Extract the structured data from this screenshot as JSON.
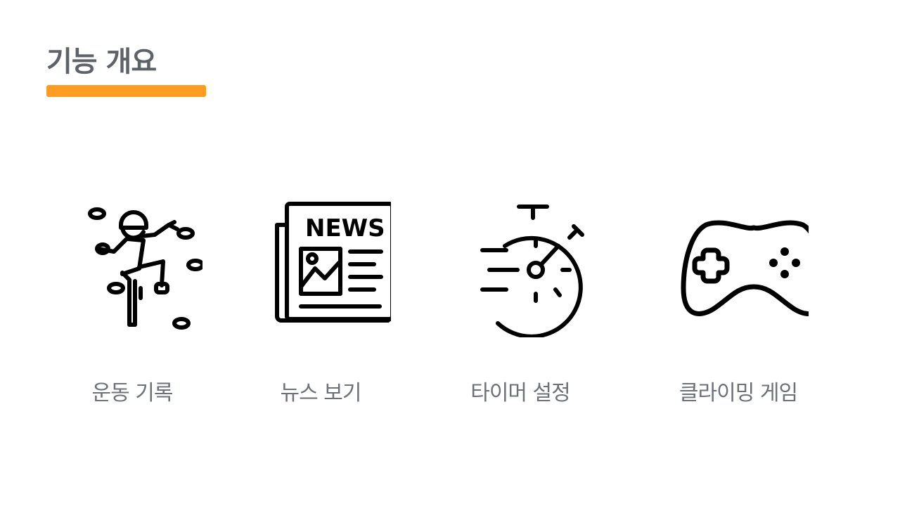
{
  "header": {
    "title": "기능 개요",
    "accent_color": "#ff9d23",
    "title_color": "#5d6369"
  },
  "features": [
    {
      "icon": "climber-icon",
      "label": "운동 기록"
    },
    {
      "icon": "newspaper-icon",
      "label": "뉴스 보기",
      "icon_text": "NEWS"
    },
    {
      "icon": "stopwatch-icon",
      "label": "타이머 설정"
    },
    {
      "icon": "gamepad-icon",
      "label": "클라이밍 게임"
    }
  ]
}
